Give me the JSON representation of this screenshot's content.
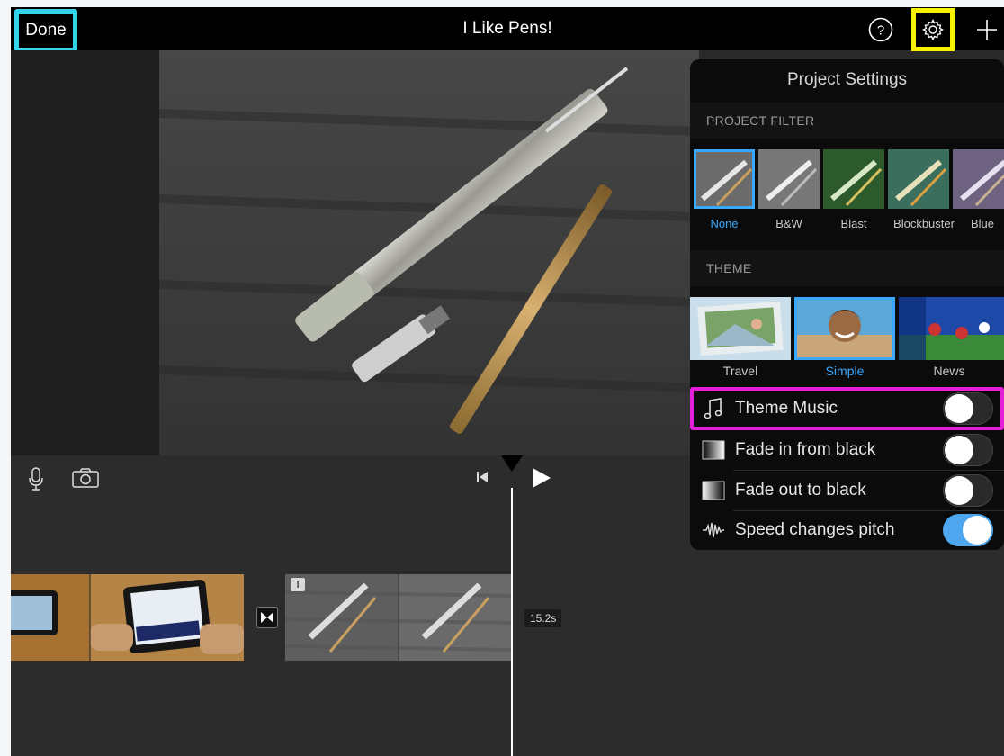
{
  "topbar": {
    "done_label": "Done",
    "title": "I Like Pens!",
    "help_icon": "question-circle-icon",
    "settings_icon": "gear-icon",
    "add_icon": "plus-icon"
  },
  "timeline": {
    "mic_icon": "microphone-icon",
    "camera_icon": "camera-icon",
    "skip_back_icon": "skip-to-start-icon",
    "play_icon": "play-icon",
    "transition_icon": "transition-icon",
    "title_marker": "T",
    "duration": "15.2s"
  },
  "settings": {
    "title": "Project Settings",
    "filter_section": "PROJECT FILTER",
    "filters": [
      {
        "label": "None",
        "selected": true
      },
      {
        "label": "B&W",
        "selected": false
      },
      {
        "label": "Blast",
        "selected": false
      },
      {
        "label": "Blockbuster",
        "selected": false
      },
      {
        "label": "Blue",
        "selected": false
      }
    ],
    "theme_section": "THEME",
    "themes": [
      {
        "label": "Travel",
        "selected": false
      },
      {
        "label": "Simple",
        "selected": true
      },
      {
        "label": "News",
        "selected": false
      }
    ],
    "options": [
      {
        "label": "Theme Music",
        "icon": "music-note-icon",
        "on": false
      },
      {
        "label": "Fade in from black",
        "icon": "gradient-square-icon",
        "on": false
      },
      {
        "label": "Fade out to black",
        "icon": "gradient-square-icon",
        "on": false
      },
      {
        "label": "Speed changes pitch",
        "icon": "waveform-icon",
        "on": true
      }
    ]
  },
  "colors": {
    "accent_blue": "#3aa8ff",
    "highlight_cyan": "#35d3ea",
    "highlight_yellow": "#f7f200",
    "highlight_magenta": "#e41fd8"
  }
}
